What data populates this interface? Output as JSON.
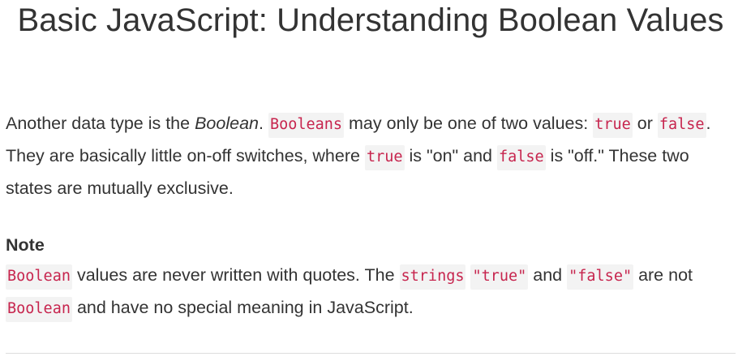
{
  "title": "Basic JavaScript: Understanding Boolean Values",
  "description": {
    "t1": "Another data type is the ",
    "em1": "Boolean",
    "t2": ". ",
    "c1": "Booleans",
    "t3": " may only be one of two values: ",
    "c2": "true",
    "t4": " or ",
    "c3": "false",
    "t5": ". They are basically little on-off switches, where ",
    "c4": "true",
    "t6": " is \"on\" and ",
    "c5": "false",
    "t7": " is \"off.\" These two states are mutually exclusive."
  },
  "note": {
    "heading": "Note",
    "c1": "Boolean",
    "t1": " values are never written with quotes. The ",
    "c2": "strings",
    "t2": " ",
    "c3": "\"true\"",
    "t3": " and ",
    "c4": "\"false\"",
    "t4": " are not ",
    "c5": "Boolean",
    "t5": " and have no special meaning in JavaScript."
  },
  "colors": {
    "text": "#333333",
    "code_text": "#c7254e",
    "code_bg": "#f3f3f3",
    "divider": "#dddddd"
  }
}
